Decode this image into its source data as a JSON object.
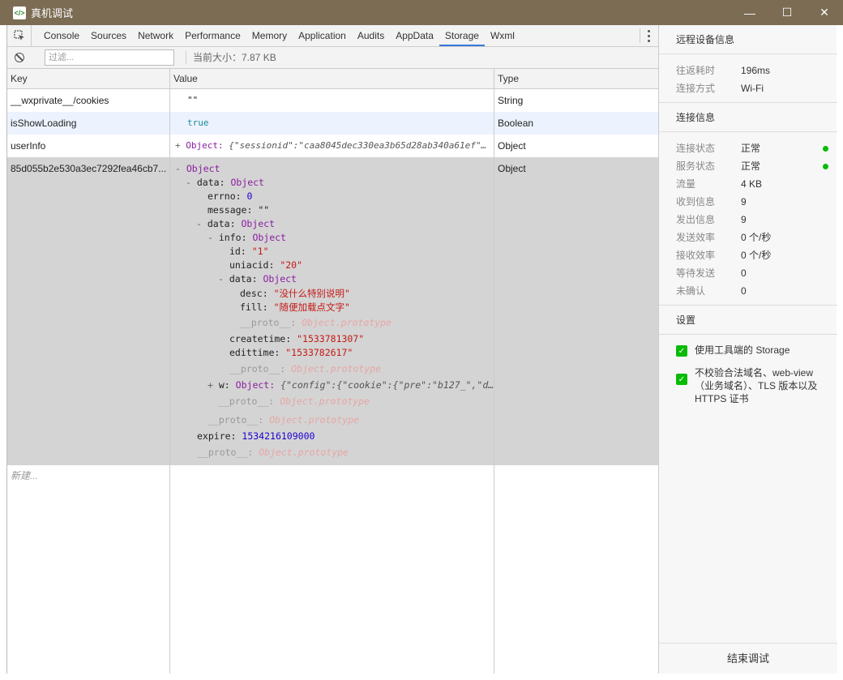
{
  "window": {
    "title": "真机调试"
  },
  "tabs": [
    "Console",
    "Sources",
    "Network",
    "Performance",
    "Memory",
    "Application",
    "Audits",
    "AppData",
    "Storage",
    "Wxml"
  ],
  "toolbar": {
    "filter_placeholder": "过滤...",
    "size_label": "当前大小：7.87 KB"
  },
  "grid": {
    "headers": {
      "key": "Key",
      "value": "Value",
      "type": "Type"
    },
    "rows": [
      {
        "key": "__wxprivate__/cookies",
        "value": "\"\"",
        "type": "String"
      },
      {
        "key": "isShowLoading",
        "value": "true",
        "type": "Boolean"
      },
      {
        "key": "userInfo",
        "value_toggle": "+",
        "value_obj": "Object:",
        "value_preview": "{\"sessionid\":\"caa8045dec330ea3b65d28ab340a61ef\"…",
        "type": "Object"
      },
      {
        "key": "85d055b2e530a3ec7292fea46cb7...",
        "type": "Object"
      }
    ],
    "new_placeholder": "新建..."
  },
  "tree": {
    "root": "Object",
    "data_key": "data:",
    "obj": "Object",
    "errno_key": "errno:",
    "errno_val": "0",
    "message_key": "message:",
    "message_val": "\"\"",
    "info_key": "info:",
    "id_key": "id:",
    "id_val": "\"1\"",
    "uniacid_key": "uniacid:",
    "uniacid_val": "\"20\"",
    "desc_key": "desc:",
    "desc_val": "\"没什么特别说明\"",
    "fill_key": "fill:",
    "fill_val": "\"随便加载点文字\"",
    "proto_key": "__proto__:",
    "proto_val": "Object.prototype",
    "createtime_key": "createtime:",
    "createtime_val": "\"1533781307\"",
    "edittime_key": "edittime:",
    "edittime_val": "\"1533782617\"",
    "w_key": "w:",
    "w_obj": "Object:",
    "w_preview": "{\"config\":{\"cookie\":{\"pre\":\"b127_\",\"d…",
    "expire_key": "expire:",
    "expire_val": "1534216109000",
    "minus": "-",
    "plus": "+"
  },
  "side": {
    "remote_title": "远程设备信息",
    "latency_label": "往返耗时",
    "latency_val": "196ms",
    "conn_label": "连接方式",
    "conn_val": "Wi-Fi",
    "conn_info_title": "连接信息",
    "stats": [
      {
        "label": "连接状态",
        "val": "正常",
        "dot": true
      },
      {
        "label": "服务状态",
        "val": "正常",
        "dot": true
      },
      {
        "label": "流量",
        "val": "4 KB"
      },
      {
        "label": "收到信息",
        "val": "9"
      },
      {
        "label": "发出信息",
        "val": "9"
      },
      {
        "label": "发送效率",
        "val": "0 个/秒"
      },
      {
        "label": "接收效率",
        "val": "0 个/秒"
      },
      {
        "label": "等待发送",
        "val": "0"
      },
      {
        "label": "未确认",
        "val": "0"
      }
    ],
    "settings_title": "设置",
    "opt1": "使用工具端的 Storage",
    "opt2": "不校验合法域名、web-view（业务域名）、TLS 版本以及 HTTPS 证书",
    "end_button": "结束调试"
  },
  "colors": {
    "titlebar": "#7b6c53",
    "accent": "#3879d9",
    "green": "#09bb07",
    "row_selected": "#d4d4d4",
    "row_alt": "#edf3fe"
  }
}
